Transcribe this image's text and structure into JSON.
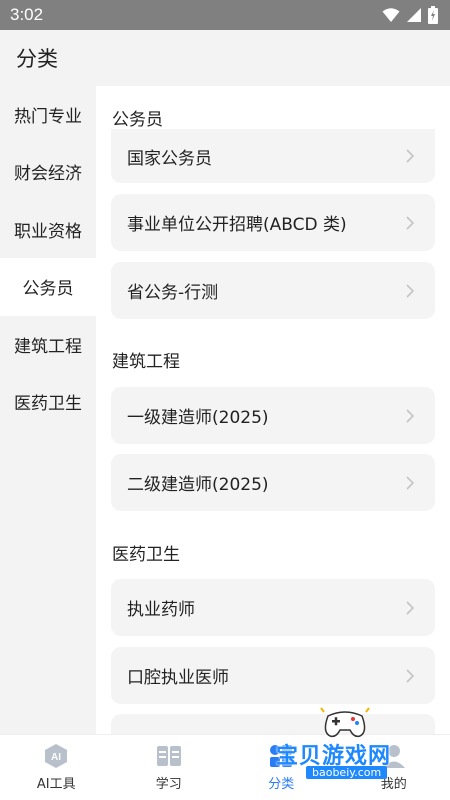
{
  "status": {
    "time": "3:02"
  },
  "header": {
    "title": "分类"
  },
  "sidebar": {
    "items": [
      {
        "label": "热门专业"
      },
      {
        "label": "财会经济"
      },
      {
        "label": "职业资格"
      },
      {
        "label": "公务员"
      },
      {
        "label": "建筑工程"
      },
      {
        "label": "医药卫生"
      }
    ],
    "active_index": 3
  },
  "sections": [
    {
      "title": "公务员",
      "items": [
        {
          "label": "国家公务员"
        },
        {
          "label": "事业单位公开招聘(ABCD 类)"
        },
        {
          "label": "省公务-行测"
        }
      ]
    },
    {
      "title": "建筑工程",
      "items": [
        {
          "label": "一级建造师(2025)"
        },
        {
          "label": "二级建造师(2025)"
        }
      ]
    },
    {
      "title": "医药卫生",
      "items": [
        {
          "label": "执业药师"
        },
        {
          "label": "口腔执业医师"
        },
        {
          "label": ""
        }
      ]
    }
  ],
  "tabbar": {
    "tabs": [
      {
        "label": "AI工具",
        "icon": "ai-tool-icon"
      },
      {
        "label": "学习",
        "icon": "book-icon"
      },
      {
        "label": "分类",
        "icon": "category-icon"
      },
      {
        "label": "我的",
        "icon": "profile-icon"
      }
    ],
    "active_index": 2
  },
  "watermark": {
    "text": "宝贝游戏网",
    "url": "baobeiy.com"
  },
  "colors": {
    "accent": "#2a7cf6",
    "status_bar": "#808080"
  }
}
